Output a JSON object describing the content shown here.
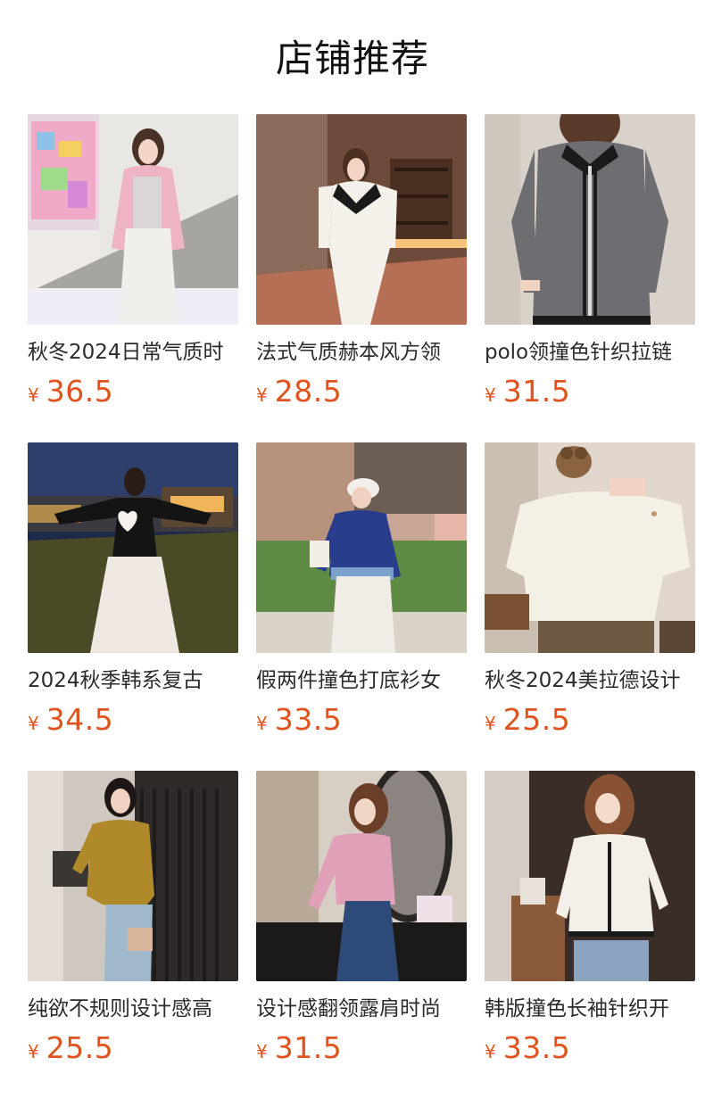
{
  "header": {
    "title": "店铺推荐"
  },
  "accent_color": "#e0531f",
  "products": [
    {
      "name": "秋冬2024日常气质时",
      "currency": "¥",
      "price": "36.5"
    },
    {
      "name": "法式气质赫本风方领",
      "currency": "¥",
      "price": "28.5"
    },
    {
      "name": "polo领撞色针织拉链",
      "currency": "¥",
      "price": "31.5"
    },
    {
      "name": "2024秋季韩系复古",
      "currency": "¥",
      "price": "34.5"
    },
    {
      "name": "假两件撞色打底衫女",
      "currency": "¥",
      "price": "33.5"
    },
    {
      "name": "秋冬2024美拉德设计",
      "currency": "¥",
      "price": "25.5"
    },
    {
      "name": "纯欲不规则设计感高",
      "currency": "¥",
      "price": "25.5"
    },
    {
      "name": "设计感翻领露肩时尚",
      "currency": "¥",
      "price": "31.5"
    },
    {
      "name": "韩版撞色长袖针织开",
      "currency": "¥",
      "price": "33.5"
    }
  ]
}
